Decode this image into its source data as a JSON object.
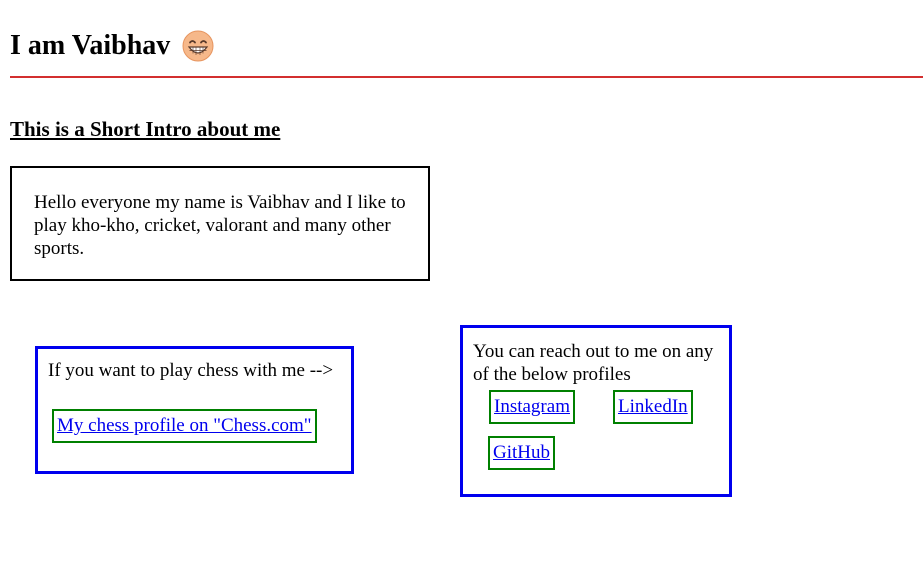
{
  "header": {
    "title": "I am Vaibhav",
    "emoji_icon": "grinning-face-with-smiling-eyes-icon"
  },
  "intro": {
    "heading": "This is a Short Intro about me",
    "text": "Hello everyone my name is Vaibhav and I like to play kho-kho, cricket, valorant and many other sports."
  },
  "chess": {
    "text": "If you want to play chess with me -->",
    "link_label": "My chess profile on \"Chess.com\""
  },
  "reach": {
    "text": "You can reach out to me on any of the below profiles",
    "links": [
      {
        "label": "Instagram"
      },
      {
        "label": "LinkedIn"
      },
      {
        "label": "GitHub"
      }
    ]
  },
  "colors": {
    "divider": "#d32f2f",
    "box_border_blue": "#0000ee",
    "link_border_green": "#008000",
    "link_text": "#0000ee"
  }
}
